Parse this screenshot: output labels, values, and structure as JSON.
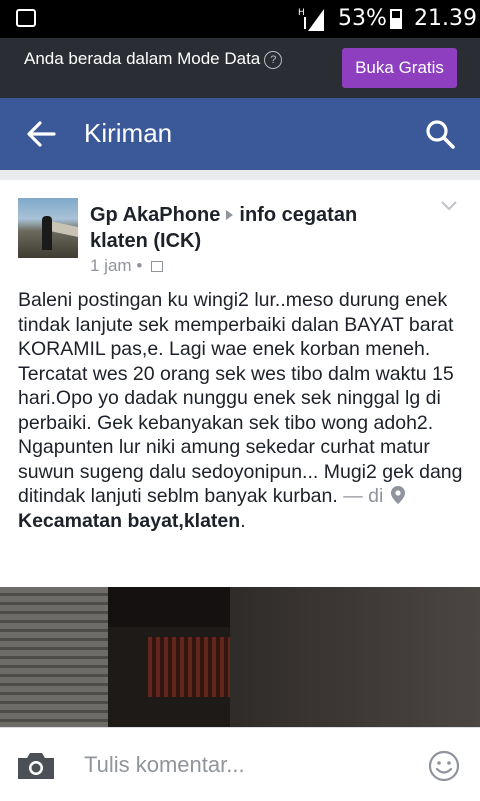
{
  "status_bar": {
    "battery_pct": "53%",
    "time": "21.39"
  },
  "data_mode": {
    "message": "Anda berada dalam Mode Data",
    "help_symbol": "?",
    "button_label": "Buka Gratis",
    "button_color": "#8e3fbf"
  },
  "app_bar": {
    "title": "Kiriman",
    "color": "#3b5998"
  },
  "post": {
    "author": "Gp AkaPhone",
    "group": "info cegatan klaten (ICK)",
    "time_ago": "1 jam",
    "dot": "•",
    "text": "Baleni postingan ku wingi2 lur..meso durung enek tindak lanjute sek memperbaiki dalan BAYAT barat KORAMIL pas,e. Lagi wae enek korban meneh. Tercatat wes 20 orang sek wes tibo dalm waktu 15 hari.Opo yo dadak nunggu enek sek ninggal lg di perbaiki. Gek kebanyakan sek tibo wong adoh2. Ngapunten lur niki amung sekedar curhat matur suwun sugeng dalu sedoyonipun... Mugi2 gek dang ditindak lanjuti seblm banyak kurban.",
    "location_prefix": "— di",
    "location": "Kecamatan bayat,klaten",
    "location_suffix": "."
  },
  "comment_bar": {
    "placeholder": "Tulis komentar..."
  }
}
